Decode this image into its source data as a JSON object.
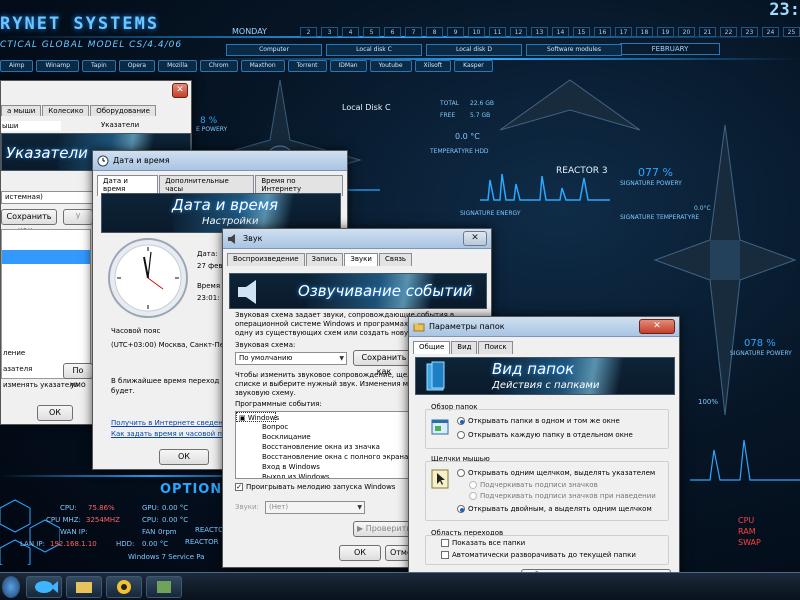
{
  "desktop": {
    "brand": "RYNET SYSTEMS",
    "brand_sub": "CTICAL GLOBAL MODEL CS/4.4/06",
    "clock": "23:",
    "day_label": "MONDAY",
    "month_label": "FEBRUARY",
    "days": [
      "2",
      "3",
      "4",
      "5",
      "6",
      "7",
      "8",
      "9",
      "10",
      "11",
      "12",
      "13",
      "14",
      "15",
      "16",
      "17",
      "18",
      "19",
      "20",
      "21",
      "22",
      "23",
      "24",
      "25",
      "26",
      "27",
      "28"
    ],
    "launchers": [
      "Aimp",
      "Winamp",
      "Tapin",
      "Opera",
      "Mozilla",
      "Chrom",
      "Maxthon",
      "Torrent",
      "IDMan",
      "Youtube",
      "Xilsoft",
      "Kasper"
    ],
    "drives": [
      "Computer",
      "Local disk C",
      "Local disk D",
      "Software modules"
    ],
    "hud": {
      "local_disk": "Local Disk C",
      "total_label": "TOTAL",
      "total_val": "22.6 GB",
      "free_label": "FREE",
      "free_val": "5.7 GB",
      "temp_hdd": "0.0 °C",
      "temp_hdd_label": "TEMPERATYRE HDD",
      "reactor": "REACTOR 3",
      "pct1": "077 %",
      "pct1_label": "SIGNATURE POWERY",
      "signature_energy": "SIGNATURE ENERGY",
      "sig_temp_label": "SIGNATURE TEMPERATYRE",
      "sig_temp": "0.0°C",
      "pct2": "078 %",
      "pct2_label": "SIGNATURE POWERY",
      "pct3": "100%",
      "top_pct": "8 %",
      "top_pct_label": "E POWERY",
      "options": "OPTION",
      "cpu_label": "CPU:",
      "cpu_val": "75.86%",
      "gpu_label": "GPU:",
      "gpu_val": "0.00 °C",
      "cpumhz_label": "CPU MHZ:",
      "cpumhz_val": "3254MHZ",
      "cpu2_label": "CPU:",
      "cpu2_val": "0.00 °C",
      "wanip_label": "WAN IP:",
      "fan_label": "FAN",
      "fan_val": "0rpm",
      "lanip_label": "LAN IP:",
      "lanip_val": "192.168.1.10",
      "hdd_label": "HDD:",
      "hdd_val": "0.00 °C",
      "reactor_short": "REACTOR",
      "reactor_short2": "REACTOR",
      "service_pack": "Windows 7 Service Pa",
      "cpu_side": "CPU",
      "ram_side": "RAM",
      "swap_side": "SWAP"
    }
  },
  "mouse_win": {
    "tabs": [
      "а мыши",
      "Колесико",
      "Оборудование"
    ],
    "row1": "ыши",
    "row1b": "Указатели",
    "banner": "Указатели",
    "scheme": "истемная)",
    "save_as": "Сохранить как...",
    "delete": "У",
    "label_a": "ление",
    "label_b": "азателя",
    "default": "По умо",
    "label_c": "изменять указатели",
    "ok": "ОК"
  },
  "datetime_win": {
    "title": "Дата и время",
    "tabs": [
      "Дата и время",
      "Дополнительные часы",
      "Время по Интернету"
    ],
    "banner1": "Дата и время",
    "banner2": "Настройки",
    "date_label": "Дата:",
    "date_val": "27 февр",
    "time_label": "Время",
    "time_val": "23:01:",
    "tz_label": "Часовой пояс",
    "tz_val": "(UTC+03:00) Москва, Санкт-Петер",
    "notice1": "В ближайшее время переход н",
    "notice2": "будет.",
    "link1": "Получить в Интернете сведени",
    "link2": "Как задать время и часовой п",
    "ok": "ОК"
  },
  "sound_win": {
    "title": "Звук",
    "tabs": [
      "Воспроизведение",
      "Запись",
      "Звуки",
      "Связь"
    ],
    "banner": "Озвучивание событий",
    "desc1": "Звуковая схема задает звуки, сопровождающие события в",
    "desc2": "операционной системе Windows и программах. Мо",
    "desc3": "одну из существующих схем или создать новую.",
    "scheme_label": "Звуковая схема:",
    "scheme_val": "По умолчанию",
    "save_as": "Сохранить как",
    "desc4": "Чтобы изменить звуковое сопровождение, щелкн",
    "desc5": "списке и выберите нужный звук. Изменения можн",
    "desc6": "звуковую схему.",
    "events_label": "Программные события:",
    "events": [
      "Windows",
      "Вопрос",
      "Восклицание",
      "Восстановление окна из значка",
      "Восстановление окна с полного экрана",
      "Вход в Windows",
      "Выход из Windows"
    ],
    "play_startup": "Проигрывать мелодию запуска Windows",
    "sounds_label": "Звуки:",
    "sounds_val": "(Нет)",
    "test": "Проверить",
    "ok": "ОК",
    "cancel": "Отмена"
  },
  "folder_win": {
    "title": "Параметры папок",
    "tabs": [
      "Общие",
      "Вид",
      "Поиск"
    ],
    "banner1": "Вид папок",
    "banner2": "Действия с папками",
    "browse_label": "Обзор папок",
    "browse_opt1": "Открывать папки в одном и том же окне",
    "browse_opt2": "Открывать каждую папку в отдельном окне",
    "click_label": "Щелчки мышью",
    "click_opt1": "Открывать одним щелчком, выделять указателем",
    "click_sub1": "Подчеркивать подписи значков",
    "click_sub2": "Подчеркивать подписи значков при наведении",
    "click_opt2": "Открывать двойным, а выделять одним щелчком",
    "nav_label": "Область переходов",
    "nav_opt1": "Показать все папки",
    "nav_opt2": "Автоматически разворачивать до текущей папки",
    "restore": "Восстановить значения по умолчанию"
  },
  "colors": {
    "accent": "#2aa7ff",
    "hud_text": "#7fc8ff",
    "close_red": "#c4402a",
    "warn_red": "#ff3a3a"
  }
}
